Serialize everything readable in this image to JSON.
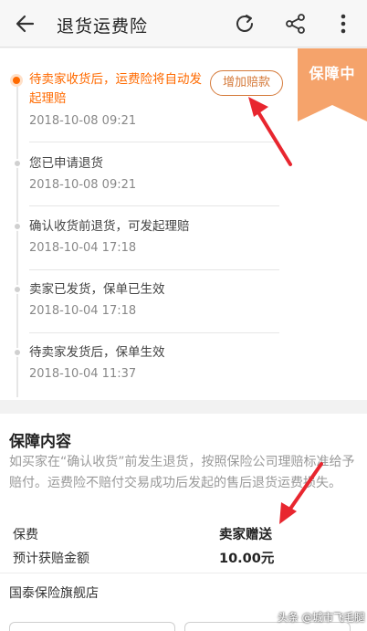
{
  "header": {
    "title": "退货运费险",
    "back_icon": "back-arrow-icon",
    "refresh_icon": "refresh-icon",
    "share_icon": "share-icon",
    "more_icon": "more-vertical-icon"
  },
  "status_ribbon": {
    "label": "保障中",
    "color": "#f5a36b"
  },
  "timeline": [
    {
      "text": "待卖家收货后，运费险将自动发起理赔",
      "time": "2018-10-08 09:21",
      "active": true
    },
    {
      "text": "您已申请退货",
      "time": "2018-10-08 09:21",
      "active": false
    },
    {
      "text": "确认收货前退货，可发起理赔",
      "time": "2018-10-04 17:18",
      "active": false
    },
    {
      "text": "卖家已发货，保单已生效",
      "time": "2018-10-04 17:18",
      "active": false
    },
    {
      "text": "待卖家发货后，保单生效",
      "time": "2018-10-04 11:37",
      "active": false
    }
  ],
  "add_claim_button": "增加赔款",
  "coverage": {
    "title": "保障内容",
    "description": "如买家在“确认收货”前发生退货，按照保险公司理赔标准给予赔付。运费险不赔付交易成功后发起的售后退货运费损失。",
    "rows": [
      {
        "label": "保费",
        "value": "卖家赠送"
      },
      {
        "label": "预计获赔金额",
        "value": "10.00元"
      }
    ],
    "insurer": "国泰保险旗舰店"
  },
  "watermark": "头条 @城市飞毛腿",
  "colors": {
    "accent": "#ff6a00",
    "arrow": "#e8262f"
  }
}
